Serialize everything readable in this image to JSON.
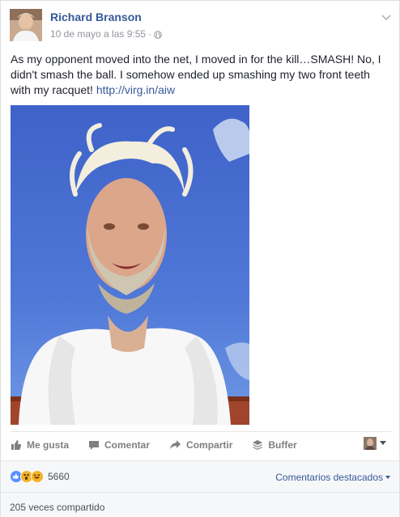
{
  "post": {
    "author": "Richard Branson",
    "timestamp": "10 de mayo a las 9:55",
    "separator": "·",
    "privacy_icon": "globe-icon",
    "text_main": "As my opponent moved into the net, I moved in for the kill…SMASH! No, I didn't smash the ball. I somehow ended up smashing my two front teeth with my racquet!",
    "link": "http://virg.in/aiw"
  },
  "actions": {
    "like": "Me gusta",
    "comment": "Comentar",
    "share": "Compartir",
    "buffer": "Buffer"
  },
  "reactions": {
    "icons": [
      "like-reaction-icon",
      "wow-reaction-icon",
      "haha-reaction-icon"
    ],
    "count": "5660",
    "top_comments": "Comentarios destacados"
  },
  "shares": "205 veces compartido",
  "colors": {
    "link": "#365899",
    "muted": "#90949c",
    "action": "#7f7f7f",
    "like_blue": "#5890ff",
    "reaction_yellow": "#f7b125"
  }
}
